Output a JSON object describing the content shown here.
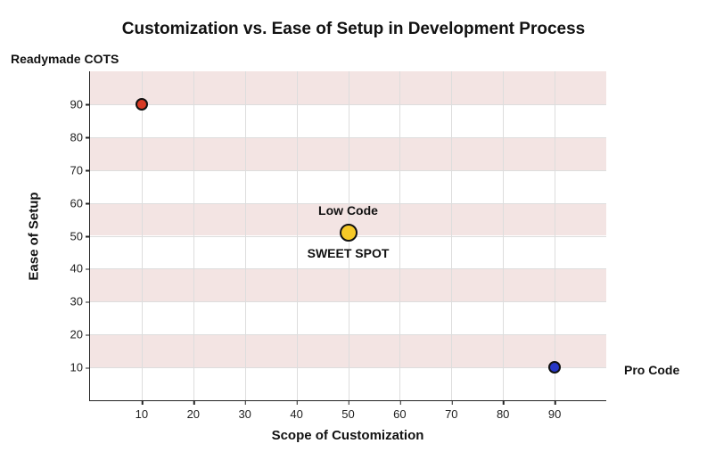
{
  "chart_data": {
    "type": "scatter",
    "title": "Customization vs. Ease of Setup in Development Process",
    "xlabel": "Scope of Customization",
    "ylabel": "Ease of Setup",
    "x_ticks": [
      10,
      20,
      30,
      40,
      50,
      60,
      70,
      80,
      90
    ],
    "y_ticks": [
      10,
      20,
      30,
      40,
      50,
      60,
      70,
      80,
      90
    ],
    "xlim": [
      0,
      100
    ],
    "ylim": [
      0,
      100
    ],
    "points": [
      {
        "name": "Readymade COTS",
        "x": 10,
        "y": 90,
        "color": "#d83a24",
        "size": 14
      },
      {
        "name": "Low Code",
        "x": 50,
        "y": 51,
        "color": "#f6c928",
        "size": 20,
        "sublabel": "SWEET SPOT"
      },
      {
        "name": "Pro Code",
        "x": 90,
        "y": 10,
        "color": "#2737c6",
        "size": 14
      }
    ]
  },
  "labels": {
    "cots": "Readymade COTS",
    "lowcode_top": "Low Code",
    "lowcode_bottom": "SWEET SPOT",
    "procode": "Pro Code"
  }
}
